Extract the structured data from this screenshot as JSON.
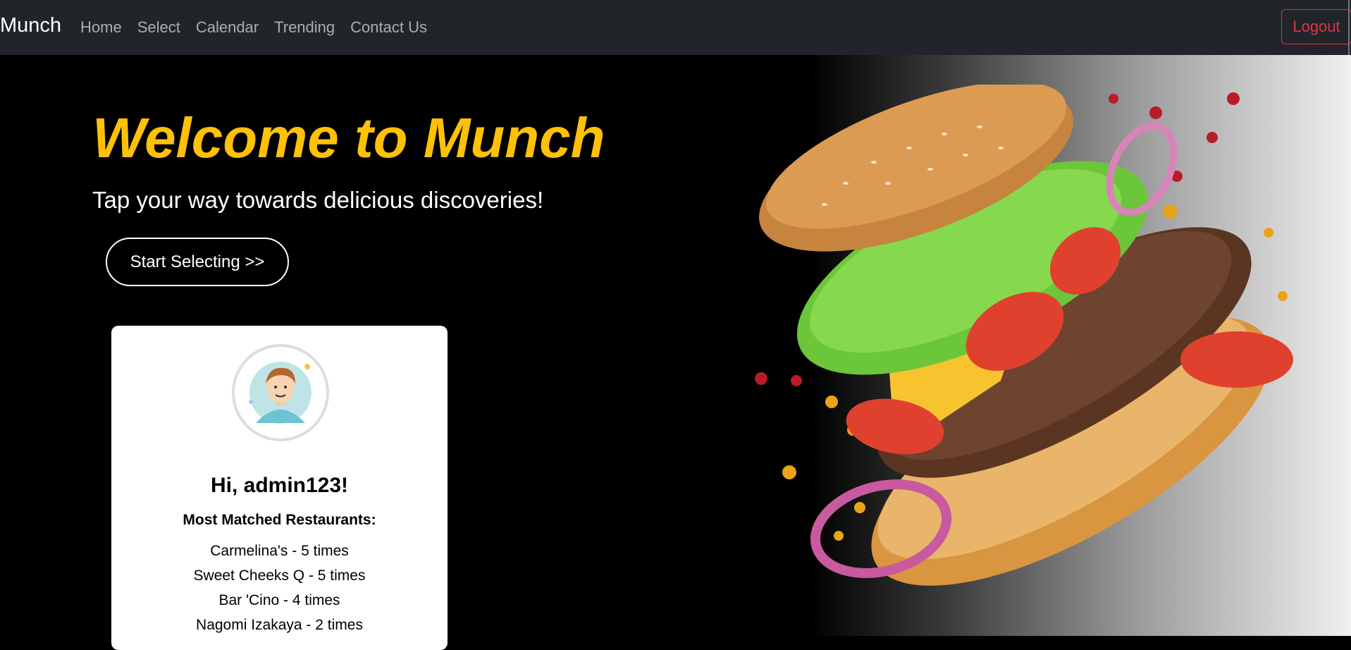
{
  "navbar": {
    "brand": "Munch",
    "links": [
      "Home",
      "Select",
      "Calendar",
      "Trending",
      "Contact Us"
    ],
    "logout_label": "Logout"
  },
  "hero": {
    "title": "Welcome to Munch",
    "subtitle": "Tap your way towards delicious discoveries!",
    "cta_label": "Start Selecting  >>"
  },
  "profile": {
    "greeting": "Hi, admin123!",
    "matched_title": "Most Matched Restaurants:",
    "matches": [
      "Carmelina's - 5 times",
      "Sweet Cheeks Q - 5 times",
      "Bar 'Cino - 4 times",
      "Nagomi Izakaya - 2 times"
    ]
  },
  "colors": {
    "navbar_bg": "#212529",
    "accent_yellow": "#ffc107",
    "logout_red": "#dc3545"
  }
}
